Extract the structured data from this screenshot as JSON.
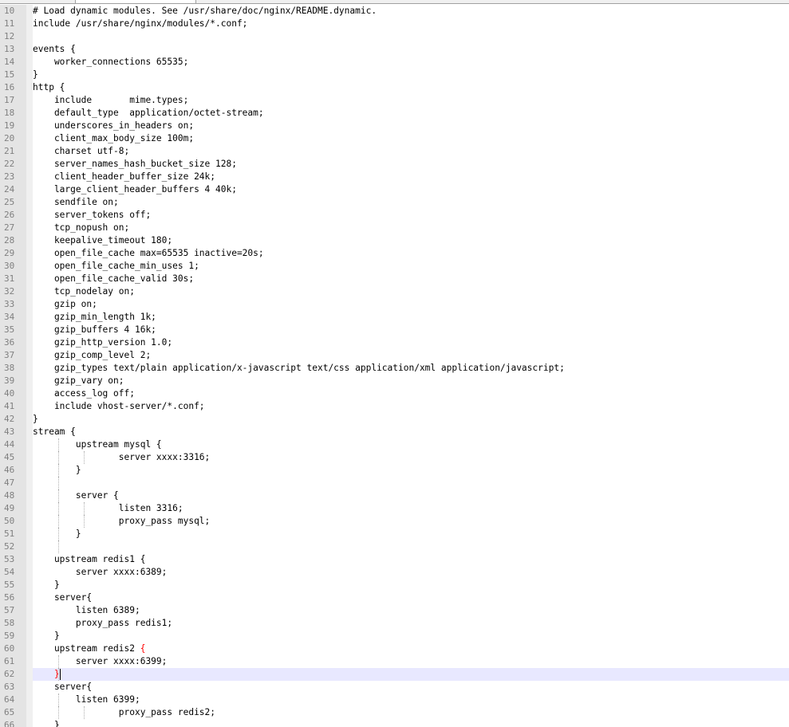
{
  "editor": {
    "current_line": "62",
    "lines": [
      {
        "num": "10",
        "text": "# Load dynamic modules. See /usr/share/doc/nginx/README.dynamic."
      },
      {
        "num": "11",
        "text": "include /usr/share/nginx/modules/*.conf;"
      },
      {
        "num": "12",
        "text": ""
      },
      {
        "num": "13",
        "text": "events {"
      },
      {
        "num": "14",
        "text": "    worker_connections 65535;"
      },
      {
        "num": "15",
        "text": "}"
      },
      {
        "num": "16",
        "text": "http {"
      },
      {
        "num": "17",
        "text": "    include       mime.types;"
      },
      {
        "num": "18",
        "text": "    default_type  application/octet-stream;"
      },
      {
        "num": "19",
        "text": "    underscores_in_headers on;"
      },
      {
        "num": "20",
        "text": "    client_max_body_size 100m;"
      },
      {
        "num": "21",
        "text": "    charset utf-8;"
      },
      {
        "num": "22",
        "text": "    server_names_hash_bucket_size 128;"
      },
      {
        "num": "23",
        "text": "    client_header_buffer_size 24k;"
      },
      {
        "num": "24",
        "text": "    large_client_header_buffers 4 40k;"
      },
      {
        "num": "25",
        "text": "    sendfile on;"
      },
      {
        "num": "26",
        "text": "    server_tokens off;"
      },
      {
        "num": "27",
        "text": "    tcp_nopush on;"
      },
      {
        "num": "28",
        "text": "    keepalive_timeout 180;"
      },
      {
        "num": "29",
        "text": "    open_file_cache max=65535 inactive=20s;"
      },
      {
        "num": "30",
        "text": "    open_file_cache_min_uses 1;"
      },
      {
        "num": "31",
        "text": "    open_file_cache_valid 30s;"
      },
      {
        "num": "32",
        "text": "    tcp_nodelay on;"
      },
      {
        "num": "33",
        "text": "    gzip on;"
      },
      {
        "num": "34",
        "text": "    gzip_min_length 1k;"
      },
      {
        "num": "35",
        "text": "    gzip_buffers 4 16k;"
      },
      {
        "num": "36",
        "text": "    gzip_http_version 1.0;"
      },
      {
        "num": "37",
        "text": "    gzip_comp_level 2;"
      },
      {
        "num": "38",
        "text": "    gzip_types text/plain application/x-javascript text/css application/xml application/javascript;"
      },
      {
        "num": "39",
        "text": "    gzip_vary on;"
      },
      {
        "num": "40",
        "text": "    access_log off;"
      },
      {
        "num": "41",
        "text": "    include vhost-server/*.conf;"
      },
      {
        "num": "42",
        "text": "}"
      },
      {
        "num": "43",
        "text": "stream {"
      },
      {
        "num": "44",
        "text": "        upstream mysql {"
      },
      {
        "num": "45",
        "text": "                server xxxx:3316;"
      },
      {
        "num": "46",
        "text": "        }"
      },
      {
        "num": "47",
        "text": ""
      },
      {
        "num": "48",
        "text": "        server {"
      },
      {
        "num": "49",
        "text": "                listen 3316;"
      },
      {
        "num": "50",
        "text": "                proxy_pass mysql;"
      },
      {
        "num": "51",
        "text": "        }"
      },
      {
        "num": "52",
        "text": ""
      },
      {
        "num": "53",
        "text": "    upstream redis1 {"
      },
      {
        "num": "54",
        "text": "        server xxxx:6389;"
      },
      {
        "num": "55",
        "text": "    }"
      },
      {
        "num": "56",
        "text": "    server{"
      },
      {
        "num": "57",
        "text": "        listen 6389;"
      },
      {
        "num": "58",
        "text": "        proxy_pass redis1;"
      },
      {
        "num": "59",
        "text": "    }"
      },
      {
        "num": "60",
        "text": "    upstream redis2 {"
      },
      {
        "num": "61",
        "text": "        server xxxx:6399;"
      },
      {
        "num": "62",
        "text": "    }"
      },
      {
        "num": "63",
        "text": "    server{"
      },
      {
        "num": "64",
        "text": "        listen 6399;"
      },
      {
        "num": "65",
        "text": "                proxy_pass redis2;"
      },
      {
        "num": "66",
        "text": "    }"
      }
    ]
  }
}
